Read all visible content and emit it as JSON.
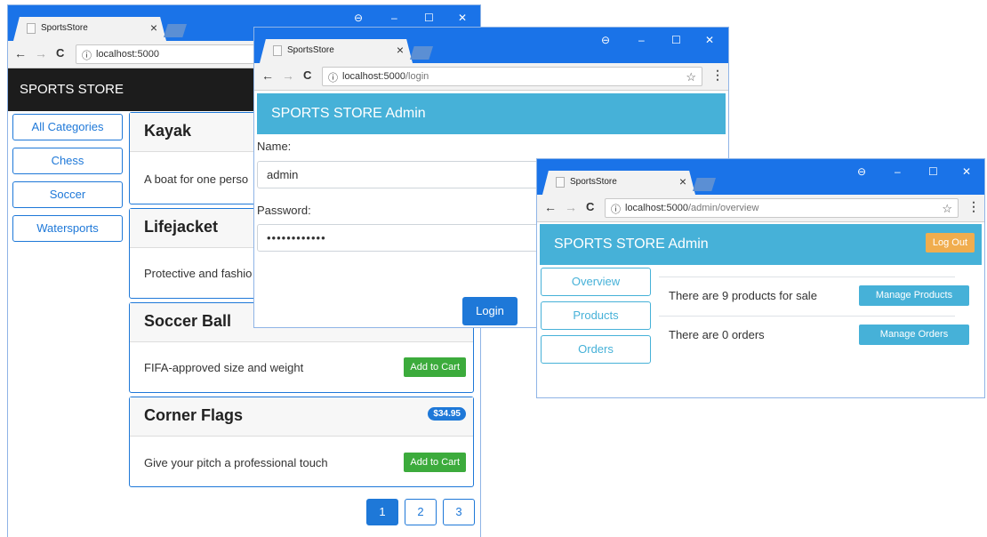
{
  "windows": {
    "store": {
      "tab_title": "SportsStore",
      "tab_close": "×",
      "url": "localhost:5000",
      "url_path": "",
      "banner_title": "SPORTS STORE",
      "categories": [
        "All Categories",
        "Chess",
        "Soccer",
        "Watersports"
      ],
      "products": [
        {
          "name": "Kayak",
          "description": "A boat for one perso",
          "price": "",
          "action": ""
        },
        {
          "name": "Lifejacket",
          "description": "Protective and fashio",
          "price": "",
          "action": ""
        },
        {
          "name": "Soccer Ball",
          "description": "FIFA-approved size and weight",
          "price": "",
          "action": "Add to Cart"
        },
        {
          "name": "Corner Flags",
          "description": "Give your pitch a professional touch",
          "price": "$34.95",
          "action": "Add to Cart"
        }
      ],
      "pages": [
        "1",
        "2",
        "3"
      ]
    },
    "login": {
      "tab_title": "SportsStore",
      "tab_close": "×",
      "url": "localhost:5000",
      "url_path": "/login",
      "banner_title": "SPORTS STORE Admin",
      "name_label": "Name:",
      "name_value": "admin",
      "password_label": "Password:",
      "password_value": "••••••••••••",
      "login_button": "Login"
    },
    "admin": {
      "tab_title": "SportsStore",
      "tab_close": "×",
      "url": "localhost:5000",
      "url_path": "/admin/overview",
      "banner_title": "SPORTS STORE Admin",
      "logout_button": "Log Out",
      "nav": [
        "Overview",
        "Products",
        "Orders"
      ],
      "summary": [
        {
          "text": "There are 9 products for sale",
          "button": "Manage Products"
        },
        {
          "text": "There are 0 orders",
          "button": "Manage Orders"
        }
      ]
    }
  },
  "browser": {
    "back": "←",
    "forward": "→",
    "reload": "C",
    "info": "ⓘ",
    "star": "☆",
    "menu": "⋮",
    "account": "⊖",
    "minimize": "–",
    "maximize": "☐",
    "close": "✕"
  },
  "colors": {
    "chrome_blue": "#1a73e8",
    "primary": "#1e78d8",
    "info": "#46b1d8",
    "success": "#3cab3c",
    "warning": "#f0ad4e",
    "dark": "#1c1c1c"
  }
}
